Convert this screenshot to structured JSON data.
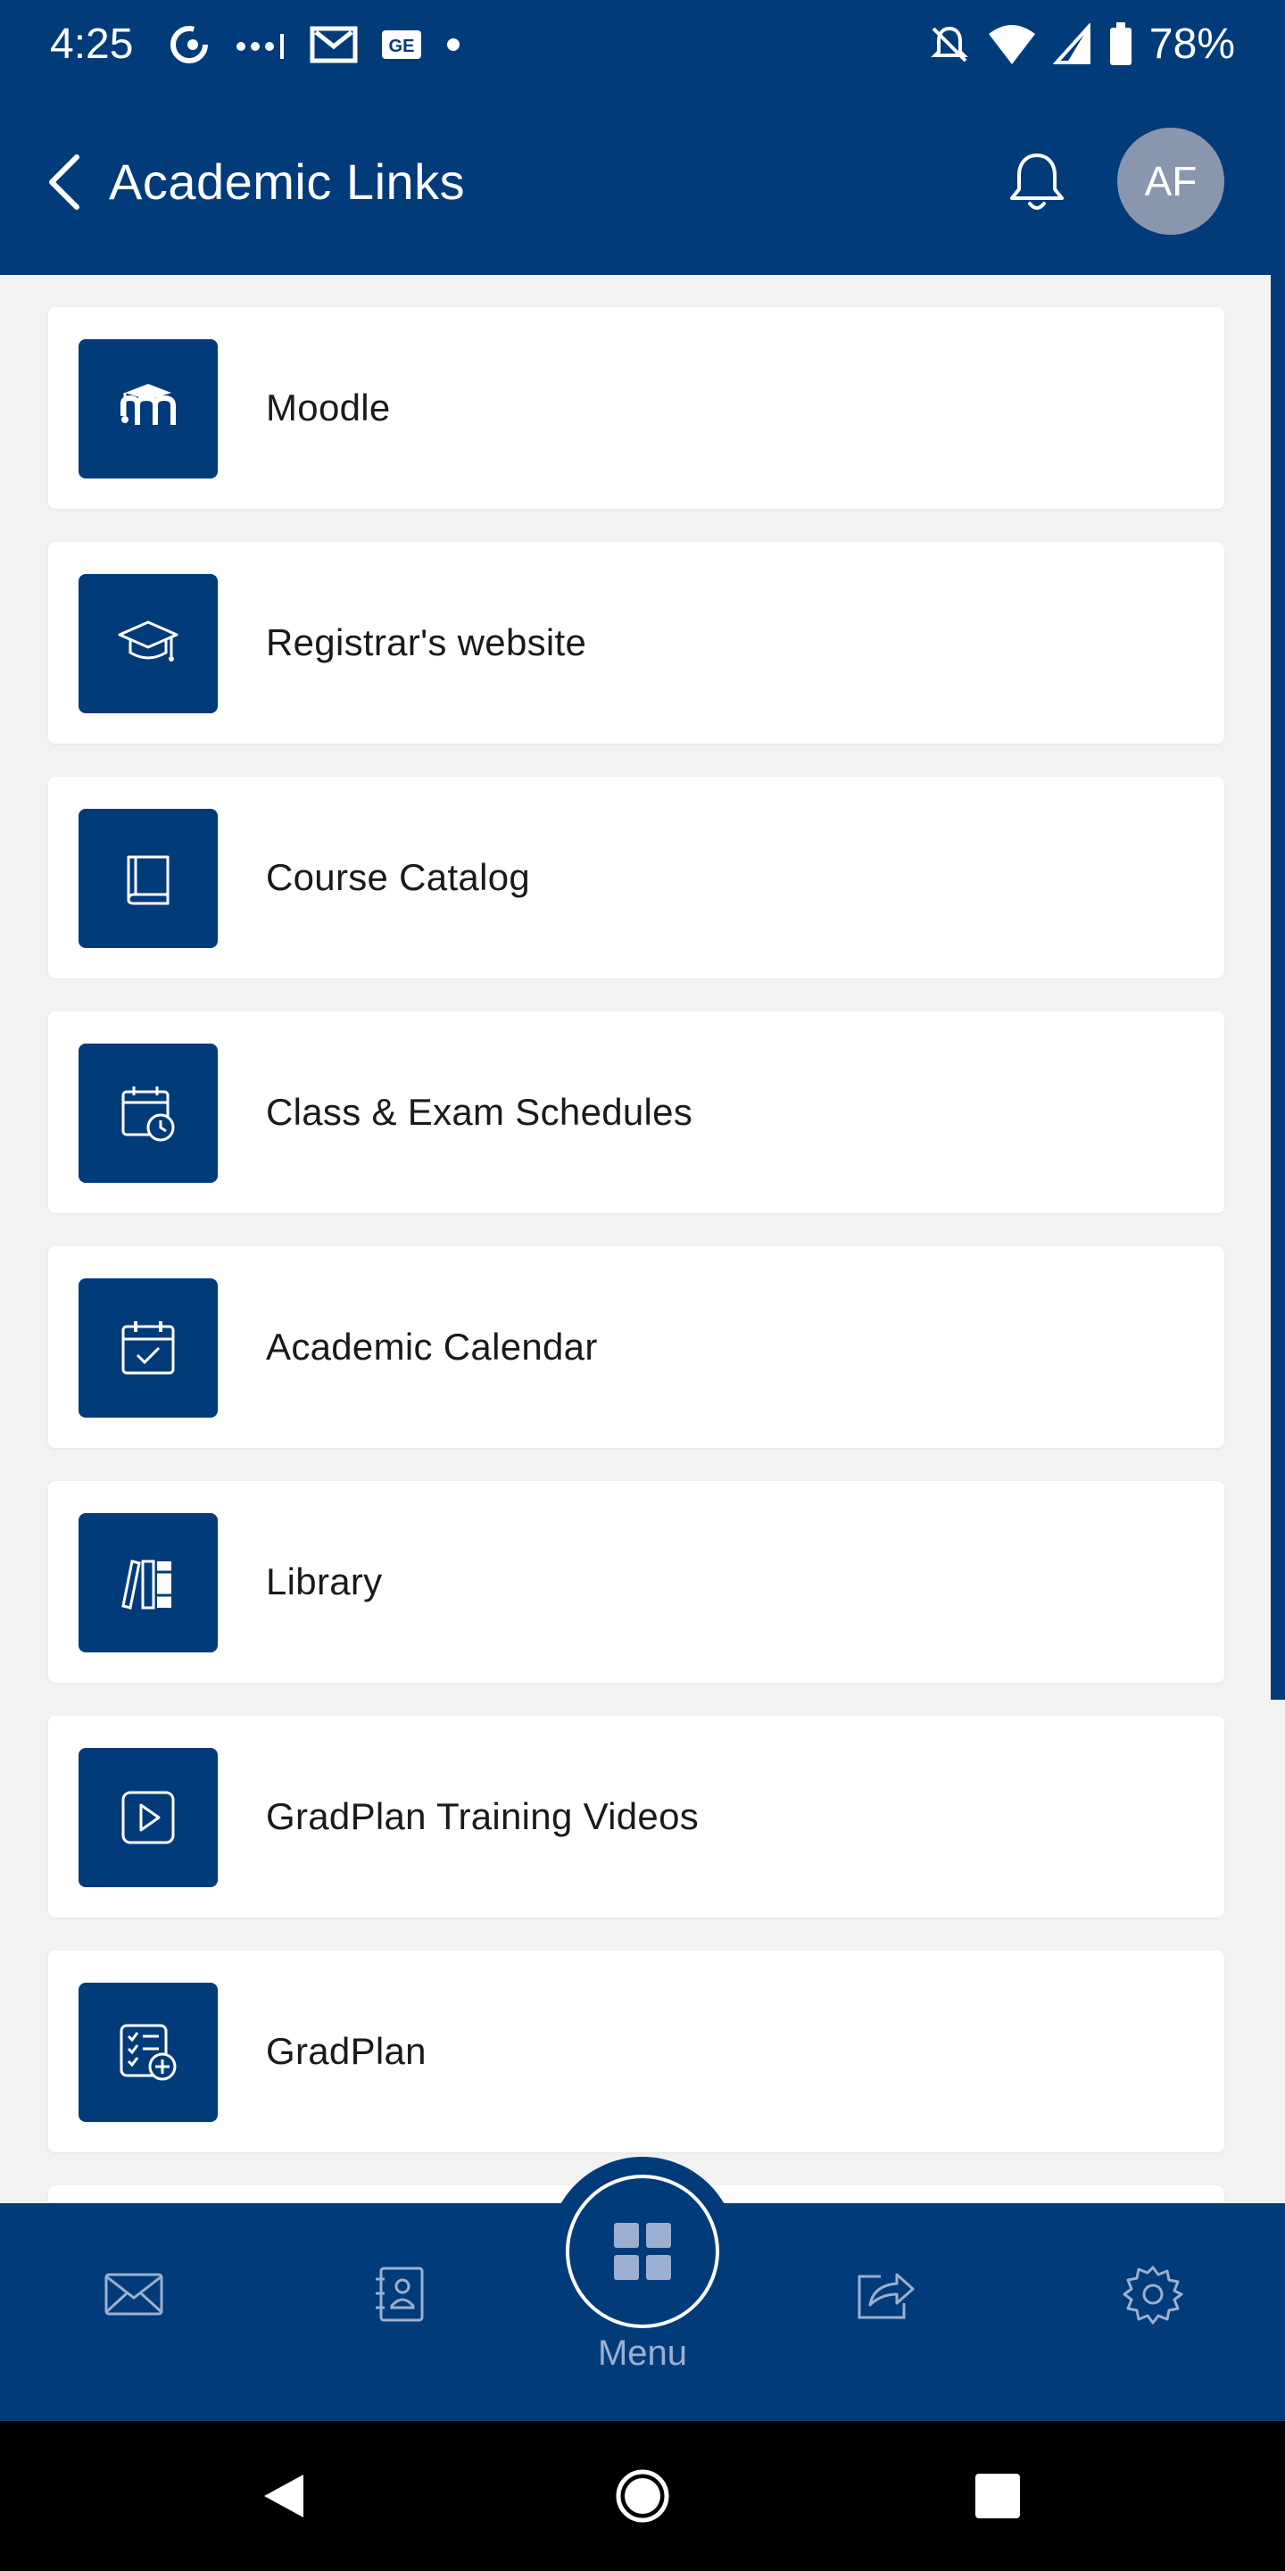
{
  "status_bar": {
    "time": "4:25",
    "battery": "78%",
    "icons_left": [
      "at-sign-icon",
      "signal-dots-icon",
      "gmail-icon",
      "ge-icon",
      "dot-icon"
    ],
    "icons_right": [
      "bell-off-icon",
      "wifi-icon",
      "cell-signal-icon",
      "battery-icon"
    ]
  },
  "header": {
    "title": "Academic Links",
    "avatar_initials": "AF",
    "background": "#023b7a"
  },
  "links": [
    {
      "label": "Moodle",
      "icon": "moodle-icon"
    },
    {
      "label": "Registrar's website",
      "icon": "graduation-cap-icon"
    },
    {
      "label": "Course Catalog",
      "icon": "book-icon"
    },
    {
      "label": "Class & Exam Schedules",
      "icon": "calendar-clock-icon"
    },
    {
      "label": "Academic Calendar",
      "icon": "calendar-check-icon"
    },
    {
      "label": "Library",
      "icon": "books-icon"
    },
    {
      "label": "GradPlan Training Videos",
      "icon": "play-video-icon"
    },
    {
      "label": "GradPlan",
      "icon": "checklist-add-icon"
    }
  ],
  "bottom_nav": {
    "items": [
      "mail-icon",
      "directory-icon",
      "menu-grid-icon",
      "share-icon",
      "settings-icon"
    ],
    "menu_label": "Menu"
  },
  "colors": {
    "primary": "#023b7a",
    "avatar": "#8a96ad",
    "background": "#f2f2f2"
  }
}
